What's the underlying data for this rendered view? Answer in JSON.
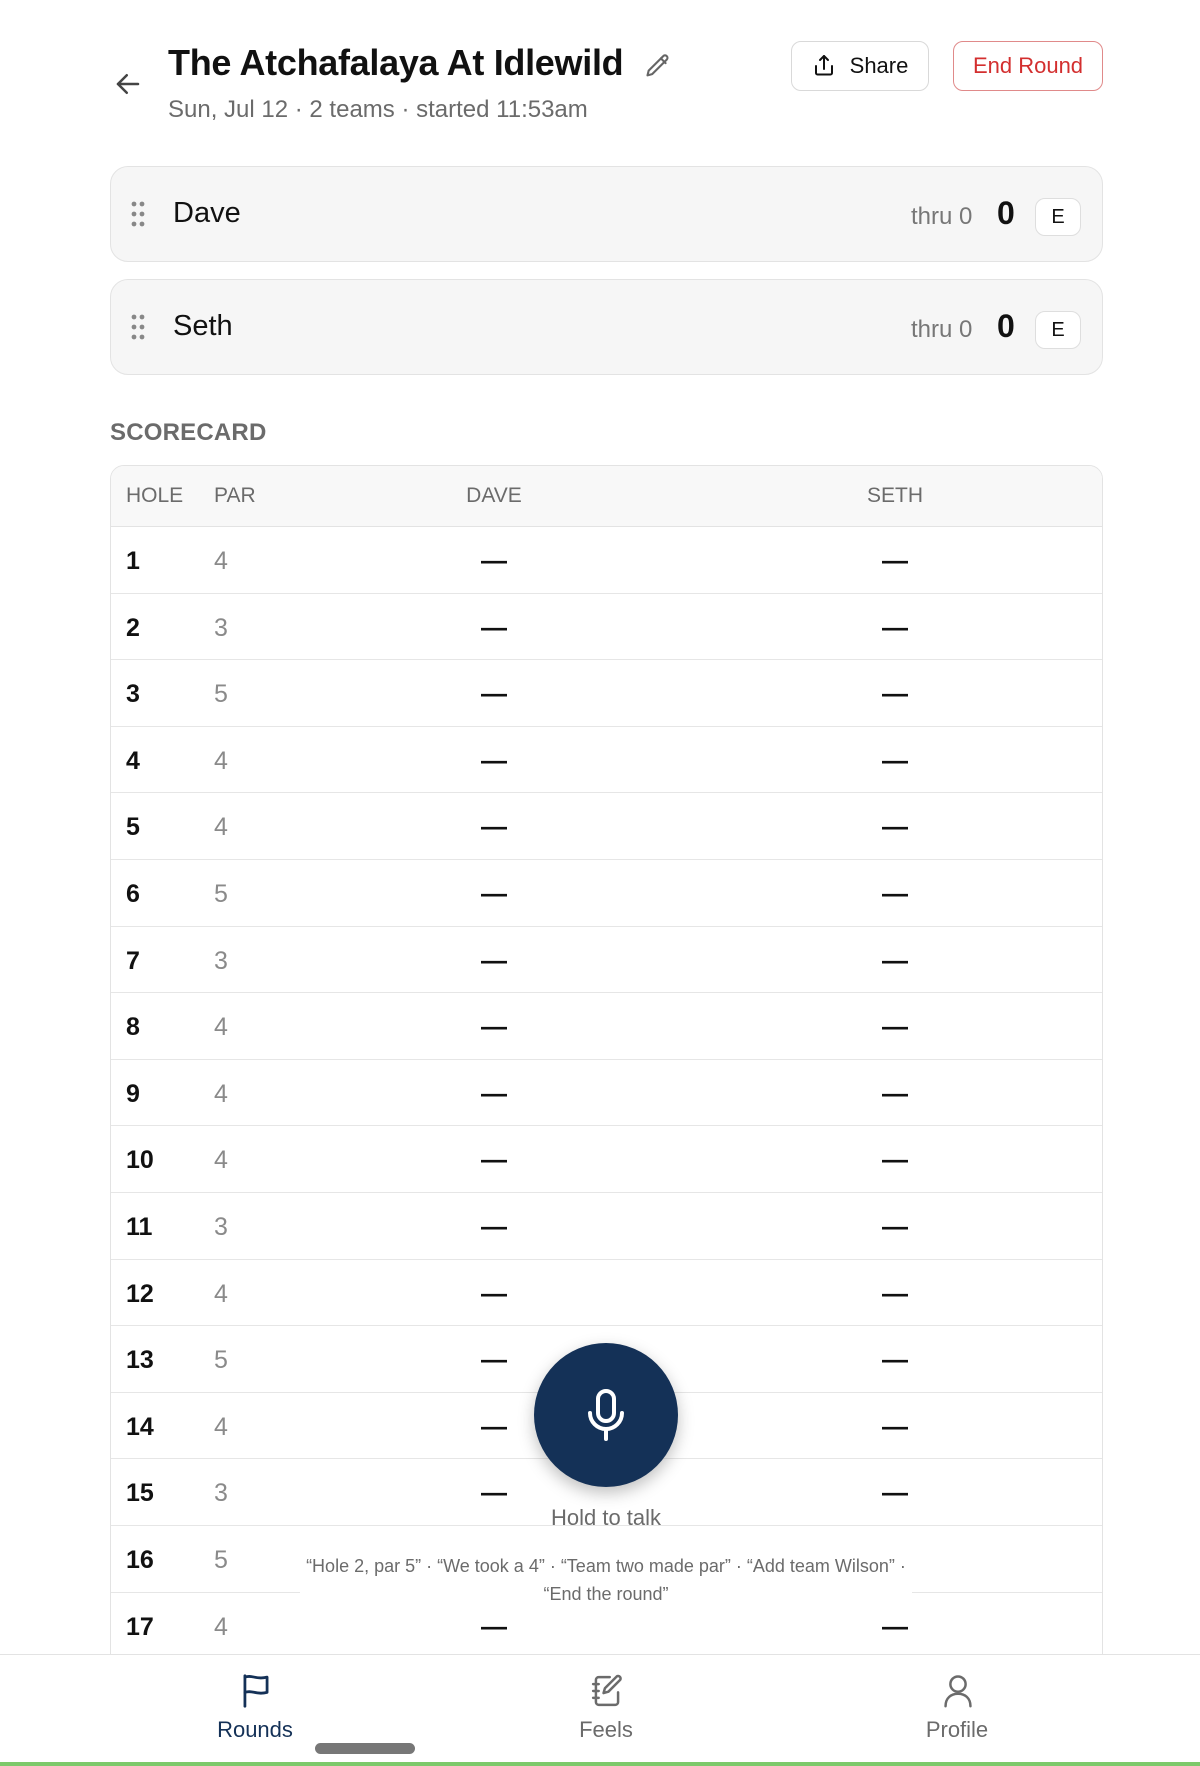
{
  "header": {
    "back_icon": "arrow-left-icon",
    "title": "The Atchafalaya At Idlewild",
    "edit_icon": "pencil-icon",
    "subtitle": "Sun, Jul 12 · 2 teams · started 11:53am",
    "share_label": "Share",
    "share_icon": "share-icon",
    "end_round_label": "End Round"
  },
  "teams": [
    {
      "name": "Dave",
      "thru": "thru 0",
      "score": "0",
      "to_par": "E"
    },
    {
      "name": "Seth",
      "thru": "thru 0",
      "score": "0",
      "to_par": "E"
    }
  ],
  "scorecard": {
    "label": "SCORECARD",
    "columns": {
      "hole": "HOLE",
      "par": "PAR",
      "dave": "DAVE",
      "seth": "SETH"
    },
    "rows": [
      {
        "hole": "1",
        "par": "4",
        "dave": "—",
        "seth": "—"
      },
      {
        "hole": "2",
        "par": "3",
        "dave": "—",
        "seth": "—"
      },
      {
        "hole": "3",
        "par": "5",
        "dave": "—",
        "seth": "—"
      },
      {
        "hole": "4",
        "par": "4",
        "dave": "—",
        "seth": "—"
      },
      {
        "hole": "5",
        "par": "4",
        "dave": "—",
        "seth": "—"
      },
      {
        "hole": "6",
        "par": "5",
        "dave": "—",
        "seth": "—"
      },
      {
        "hole": "7",
        "par": "3",
        "dave": "—",
        "seth": "—"
      },
      {
        "hole": "8",
        "par": "4",
        "dave": "—",
        "seth": "—"
      },
      {
        "hole": "9",
        "par": "4",
        "dave": "—",
        "seth": "—"
      },
      {
        "hole": "10",
        "par": "4",
        "dave": "—",
        "seth": "—"
      },
      {
        "hole": "11",
        "par": "3",
        "dave": "—",
        "seth": "—"
      },
      {
        "hole": "12",
        "par": "4",
        "dave": "—",
        "seth": "—"
      },
      {
        "hole": "13",
        "par": "5",
        "dave": "—",
        "seth": "—"
      },
      {
        "hole": "14",
        "par": "4",
        "dave": "—",
        "seth": "—"
      },
      {
        "hole": "15",
        "par": "3",
        "dave": "—",
        "seth": "—"
      },
      {
        "hole": "16",
        "par": "5",
        "dave": "—",
        "seth": "—"
      },
      {
        "hole": "17",
        "par": "4",
        "dave": "—",
        "seth": "—"
      }
    ]
  },
  "voice": {
    "mic_icon": "microphone-icon",
    "hold_label": "Hold to talk",
    "hints": "“Hole 2, par 5” · “We took a 4” · “Team two made par” · “Add team Wilson” · “End the round”"
  },
  "tabs": [
    {
      "label": "Rounds",
      "icon": "flag-icon",
      "active": true
    },
    {
      "label": "Feels",
      "icon": "notebook-pen-icon",
      "active": false
    },
    {
      "label": "Profile",
      "icon": "user-icon",
      "active": false
    }
  ],
  "colors": {
    "primary": "#143157",
    "danger": "#d32f2f",
    "muted_text": "#6b6b6b",
    "card_bg": "#f6f6f6",
    "border": "#e3e3e3"
  }
}
